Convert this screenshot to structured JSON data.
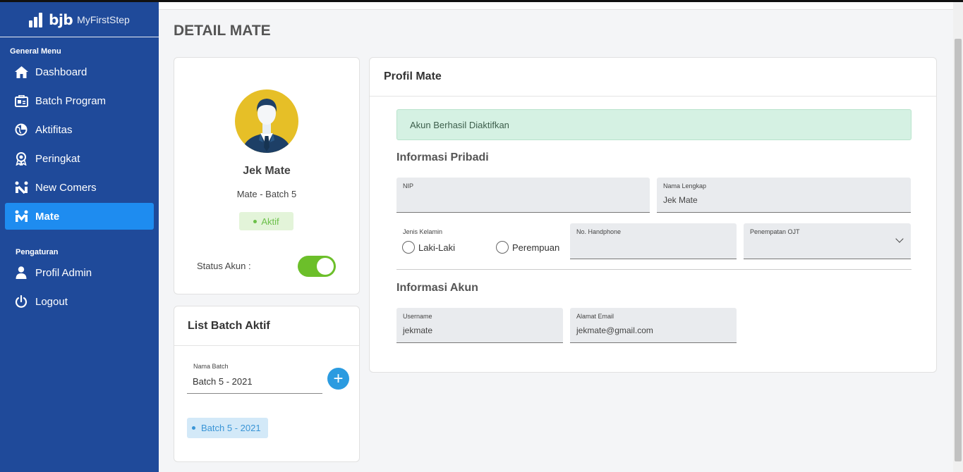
{
  "app": {
    "brand": "bjb",
    "brand_sub": "MyFirstStep"
  },
  "sidebar": {
    "general_title": "General Menu",
    "settings_title": "Pengaturan",
    "items": [
      {
        "label": "Dashboard",
        "icon": "home-icon"
      },
      {
        "label": "Batch Program",
        "icon": "batch-program-icon"
      },
      {
        "label": "Aktifitas",
        "icon": "activity-icon"
      },
      {
        "label": "Peringkat",
        "icon": "award-icon"
      },
      {
        "label": "New Comers",
        "icon": "new-comers-icon"
      },
      {
        "label": "Mate",
        "icon": "mate-icon",
        "active": true
      }
    ],
    "settings_items": [
      {
        "label": "Profil Admin",
        "icon": "user-icon"
      },
      {
        "label": "Logout",
        "icon": "power-icon"
      }
    ]
  },
  "page": {
    "title": "DETAIL MATE"
  },
  "profile": {
    "name": "Jek Mate",
    "batch": "Mate - Batch 5",
    "status_badge": "Aktif",
    "status_label": "Status Akun :",
    "status_on": true
  },
  "batch_list": {
    "title": "List Batch Aktif",
    "field_label": "Nama Batch",
    "field_value": "Batch 5 - 2021",
    "add_symbol": "+",
    "chips": [
      "Batch 5 - 2021"
    ]
  },
  "profil_mate": {
    "title": "Profil Mate",
    "alert": "Akun Berhasil Diaktifkan",
    "personal_title": "Informasi Pribadi",
    "nip_label": "NIP",
    "nip_value": "",
    "fullname_label": "Nama Lengkap",
    "fullname_value": "Jek Mate",
    "gender_label": "Jenis Kelamin",
    "gender_options": [
      "Laki-Laki",
      "Perempuan"
    ],
    "phone_label": "No. Handphone",
    "phone_value": "",
    "placement_label": "Penempatan OJT",
    "placement_value": "",
    "account_title": "Informasi Akun",
    "username_label": "Username",
    "username_value": "jekmate",
    "email_label": "Alamat Email",
    "email_value": "jekmate@gmail.com"
  },
  "colors": {
    "sidebar_bg": "#1f4a9a",
    "active_item": "#1e8cf0",
    "toggle_on": "#6cbf2a",
    "alert_bg": "#d5f1e3",
    "add_button": "#2b9be0"
  }
}
